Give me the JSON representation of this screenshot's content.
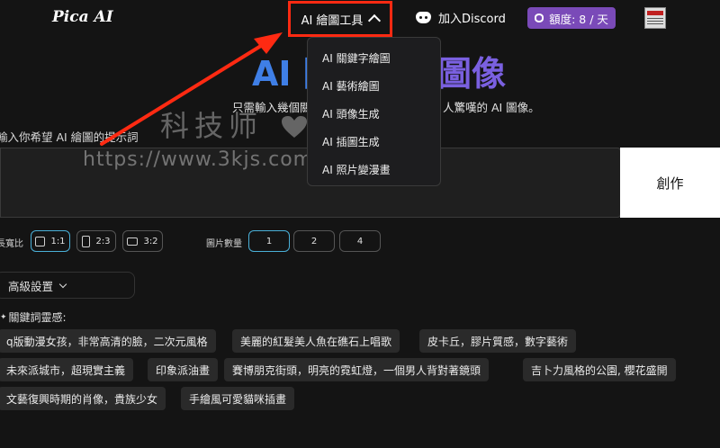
{
  "header": {
    "logo": "Pica AI",
    "tools_label": "AI 繪圖工具",
    "discord_label": "加入Discord",
    "quota_label": "額度: 8 / 天"
  },
  "hero": {
    "title_left": "AI 圖",
    "title_right": "圖像",
    "subtitle_left": "只需輸入幾個關",
    "subtitle_right": "人驚嘆的 AI 圖像。",
    "prompt_label": "輸入你希望 AI 繪圖的提示詞"
  },
  "watermark": {
    "text": "科技师",
    "url": "https://www.3kjs.com"
  },
  "prompt": {
    "value": "",
    "create_label": "創作"
  },
  "options": {
    "ratio_label": "長寬比",
    "ratios": [
      "1:1",
      "2:3",
      "3:2"
    ],
    "selected_ratio": "1:1",
    "count_label": "圖片數量",
    "counts": [
      "1",
      "2",
      "4"
    ],
    "selected_count": "1"
  },
  "advanced": {
    "label": "高級設置"
  },
  "keywords": {
    "label": "關鍵詞靈感:",
    "chips": [
      "q版動漫女孩，非常高清的臉，二次元風格",
      "美麗的紅髮美人魚在礁石上唱歌",
      "皮卡丘，膠片質感，數字藝術",
      "未來派城市，超現實主義",
      "印象派油畫",
      "賽博朋克街頭，明亮的霓虹燈，一個男人背對著鏡頭",
      "吉卜力風格的公園, 櫻花盛開",
      "文藝復興時期的肖像，貴族少女",
      "手繪風可愛貓咪插畫"
    ]
  },
  "menu": {
    "items": [
      "AI 關鍵字繪圖",
      "AI 藝術繪圖",
      "AI 頭像生成",
      "AI 插圖生成",
      "AI 照片變漫畫"
    ]
  },
  "colors": {
    "background": "#141414",
    "highlight_box": "#ff2a12",
    "title_blue": "#3f7fe6",
    "title_purple": "#7a60e0",
    "quota_bg": "#7a4ab8",
    "active_border": "#4ab0d8"
  }
}
